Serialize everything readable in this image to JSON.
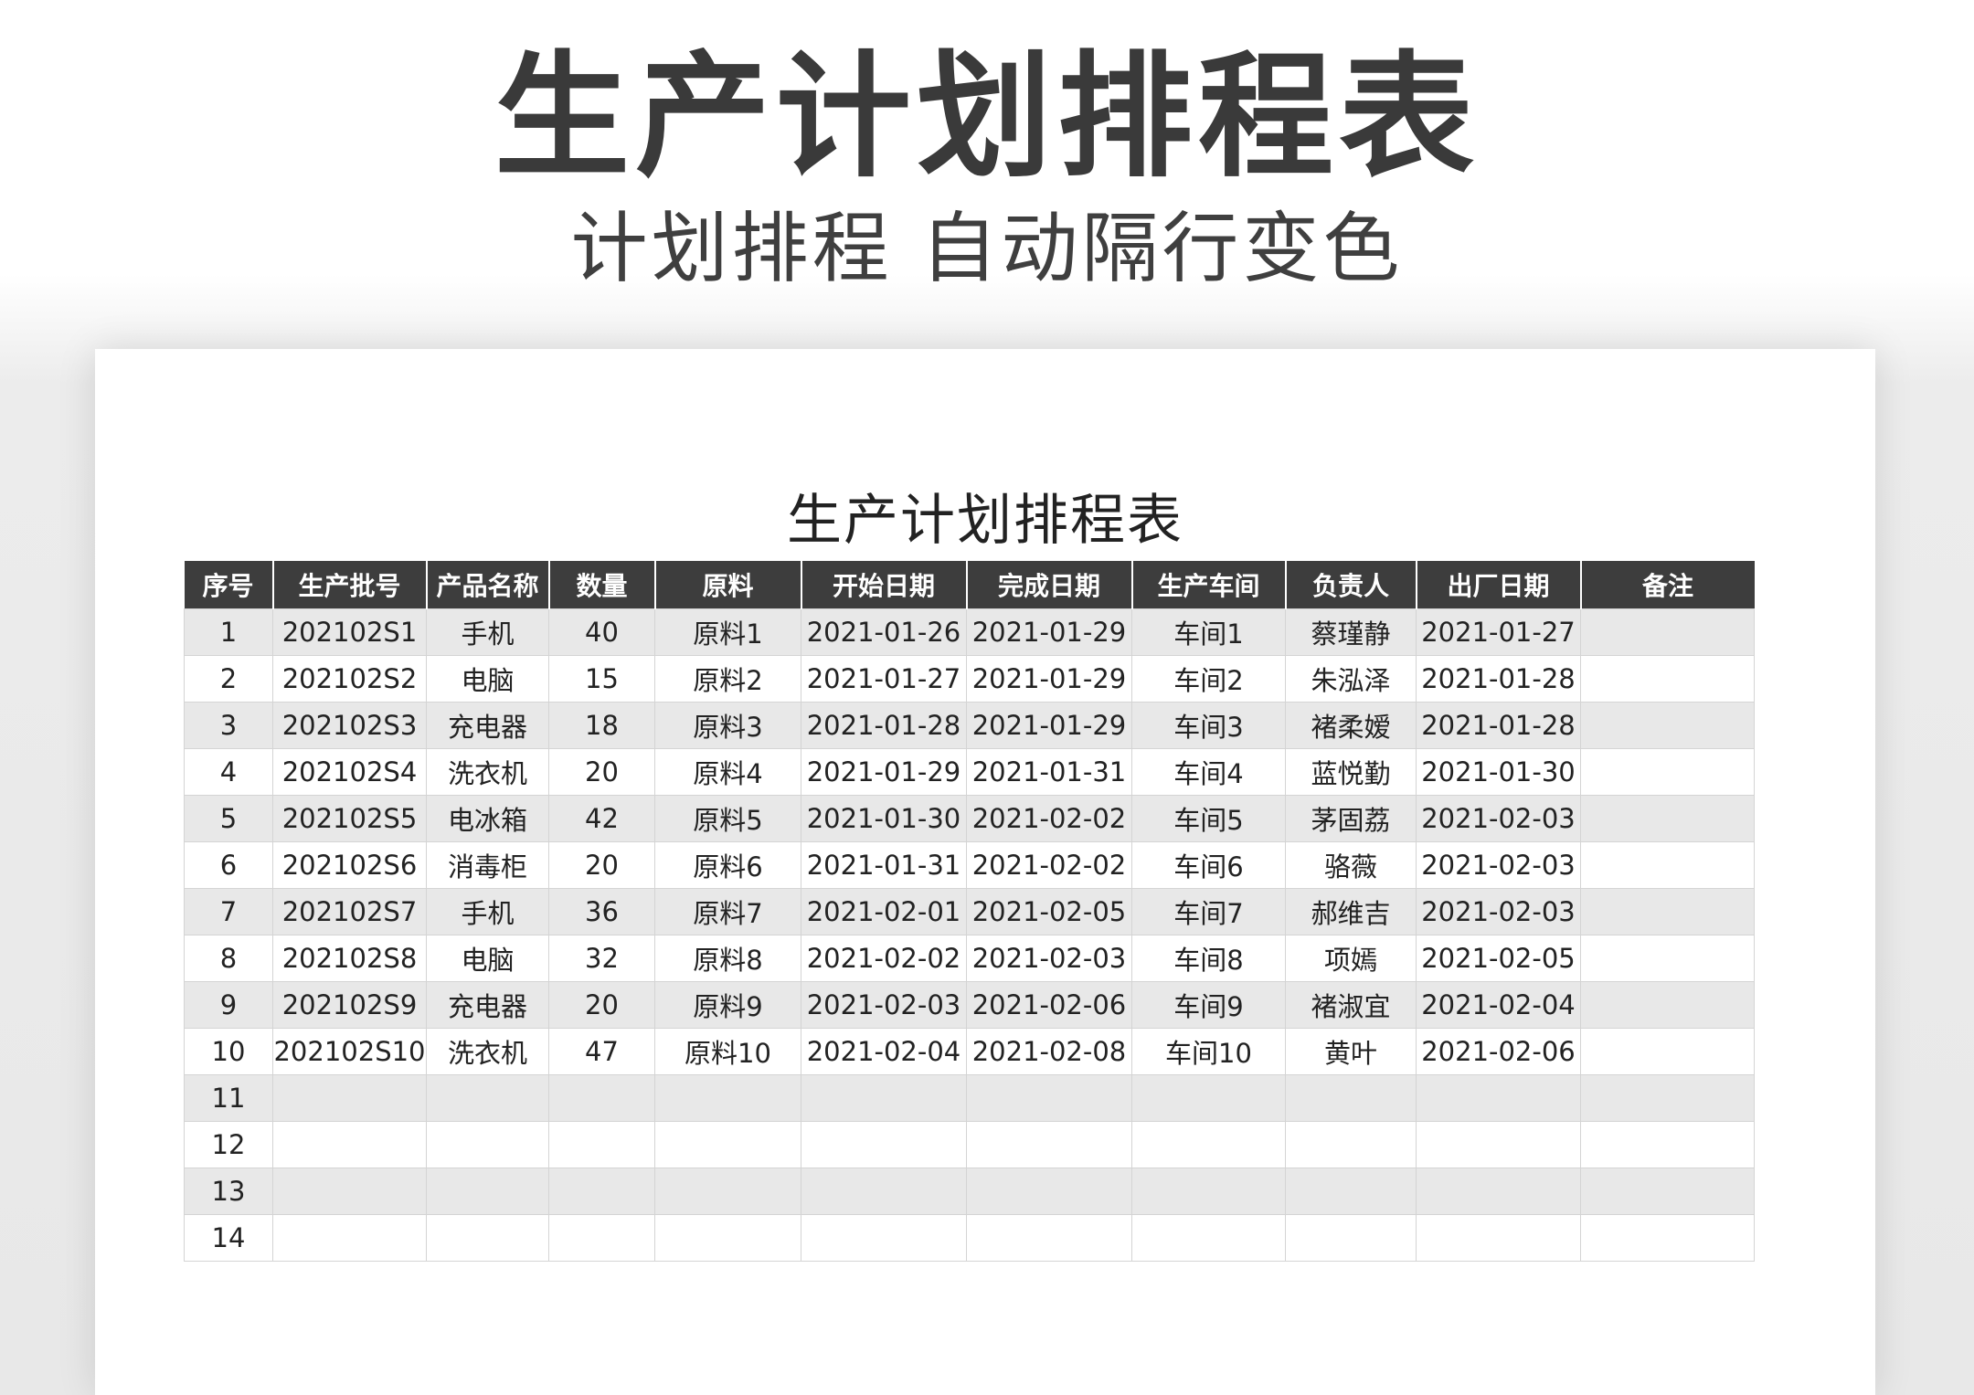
{
  "hero": {
    "title": "生产计划排程表",
    "subtitle": "计划排程 自动隔行变色"
  },
  "sheet": {
    "title": "生产计划排程表",
    "columns": [
      "序号",
      "生产批号",
      "产品名称",
      "数量",
      "原料",
      "开始日期",
      "完成日期",
      "生产车间",
      "负责人",
      "出厂日期",
      "备注"
    ],
    "rows": [
      [
        "1",
        "202102S1",
        "手机",
        "40",
        "原料1",
        "2021-01-26",
        "2021-01-29",
        "车间1",
        "蔡瑾静",
        "2021-01-27",
        ""
      ],
      [
        "2",
        "202102S2",
        "电脑",
        "15",
        "原料2",
        "2021-01-27",
        "2021-01-29",
        "车间2",
        "朱泓泽",
        "2021-01-28",
        ""
      ],
      [
        "3",
        "202102S3",
        "充电器",
        "18",
        "原料3",
        "2021-01-28",
        "2021-01-29",
        "车间3",
        "褚柔嫒",
        "2021-01-28",
        ""
      ],
      [
        "4",
        "202102S4",
        "洗衣机",
        "20",
        "原料4",
        "2021-01-29",
        "2021-01-31",
        "车间4",
        "蓝悦勤",
        "2021-01-30",
        ""
      ],
      [
        "5",
        "202102S5",
        "电冰箱",
        "42",
        "原料5",
        "2021-01-30",
        "2021-02-02",
        "车间5",
        "茅固荔",
        "2021-02-03",
        ""
      ],
      [
        "6",
        "202102S6",
        "消毒柜",
        "20",
        "原料6",
        "2021-01-31",
        "2021-02-02",
        "车间6",
        "骆薇",
        "2021-02-03",
        ""
      ],
      [
        "7",
        "202102S7",
        "手机",
        "36",
        "原料7",
        "2021-02-01",
        "2021-02-05",
        "车间7",
        "郝维吉",
        "2021-02-03",
        ""
      ],
      [
        "8",
        "202102S8",
        "电脑",
        "32",
        "原料8",
        "2021-02-02",
        "2021-02-03",
        "车间8",
        "项嫣",
        "2021-02-05",
        ""
      ],
      [
        "9",
        "202102S9",
        "充电器",
        "20",
        "原料9",
        "2021-02-03",
        "2021-02-06",
        "车间9",
        "褚淑宜",
        "2021-02-04",
        ""
      ],
      [
        "10",
        "202102S10",
        "洗衣机",
        "47",
        "原料10",
        "2021-02-04",
        "2021-02-08",
        "车间10",
        "黄叶",
        "2021-02-06",
        ""
      ],
      [
        "11",
        "",
        "",
        "",
        "",
        "",
        "",
        "",
        "",
        "",
        ""
      ],
      [
        "12",
        "",
        "",
        "",
        "",
        "",
        "",
        "",
        "",
        "",
        ""
      ],
      [
        "13",
        "",
        "",
        "",
        "",
        "",
        "",
        "",
        "",
        "",
        ""
      ],
      [
        "14",
        "",
        "",
        "",
        "",
        "",
        "",
        "",
        "",
        "",
        ""
      ]
    ]
  }
}
